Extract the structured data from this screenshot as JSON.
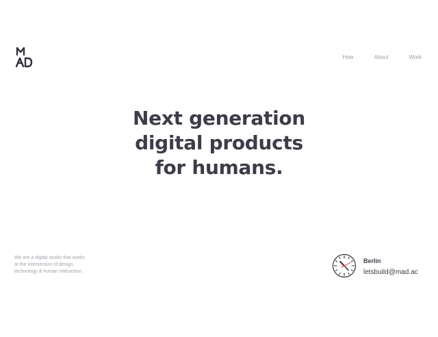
{
  "brand": {
    "logo_text": "MAD",
    "logo_name": "mad-logo"
  },
  "nav": {
    "items": [
      {
        "label": "How"
      },
      {
        "label": "About"
      },
      {
        "label": "Work"
      }
    ]
  },
  "hero": {
    "lines": [
      "Next generation",
      "digital products",
      "for humans."
    ]
  },
  "intro": {
    "lines": [
      "We are a digital studio that works",
      "at the intersection of design,",
      "technology & human interaction."
    ]
  },
  "contact": {
    "city": "Berlin",
    "email": "letsbuild@mad.ac",
    "clock_icon": "clock-icon"
  },
  "colors": {
    "text": "#3c3d49",
    "muted": "#9a9ca4",
    "accent": "#e0383e"
  }
}
